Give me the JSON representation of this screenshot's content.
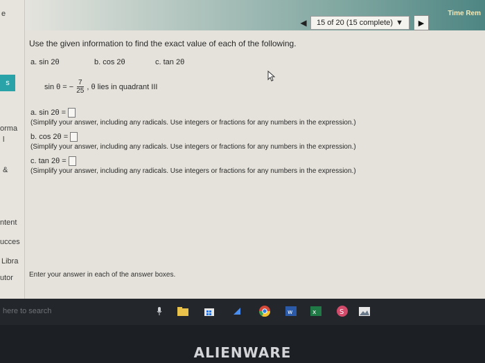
{
  "sidebar": {
    "top_label": "e",
    "active_item": "s",
    "items": [
      "orma",
      "l",
      "&",
      "ntent",
      "ucces",
      "Libra",
      "utor"
    ]
  },
  "header": {
    "pager_text": "15 of 20 (15 complete)",
    "timer_label": "Time Rem"
  },
  "question": {
    "instruction": "Use the given information to find the exact value of each of the following.",
    "parts": [
      "a. sin 2θ",
      "b. cos 2θ",
      "c. tan 2θ"
    ],
    "given_prefix": "sin θ = −",
    "given_num": "7",
    "given_den": "25",
    "given_suffix": ", θ lies in quadrant III"
  },
  "answers": [
    {
      "label": "a. sin 2θ =",
      "value": "",
      "hint": "(Simplify your answer, including any radicals. Use integers or fractions for any numbers in the expression.)"
    },
    {
      "label": "b. cos 2θ =",
      "value": "",
      "hint": "(Simplify your answer, including any radicals. Use integers or fractions for any numbers in the expression.)"
    },
    {
      "label": "c. tan 2θ =",
      "value": "",
      "hint": "(Simplify your answer, including any radicals. Use integers or fractions for any numbers in the expression.)"
    }
  ],
  "footer": {
    "note": "Enter your answer in each of the answer boxes."
  },
  "taskbar": {
    "search_placeholder": "here to search",
    "icons": [
      "microphone-icon",
      "file-explorer-icon",
      "store-icon",
      "edge-icon",
      "chrome-icon",
      "word-icon",
      "excel-icon",
      "app-icon",
      "photos-icon"
    ]
  },
  "brand": "ALIENWARE"
}
